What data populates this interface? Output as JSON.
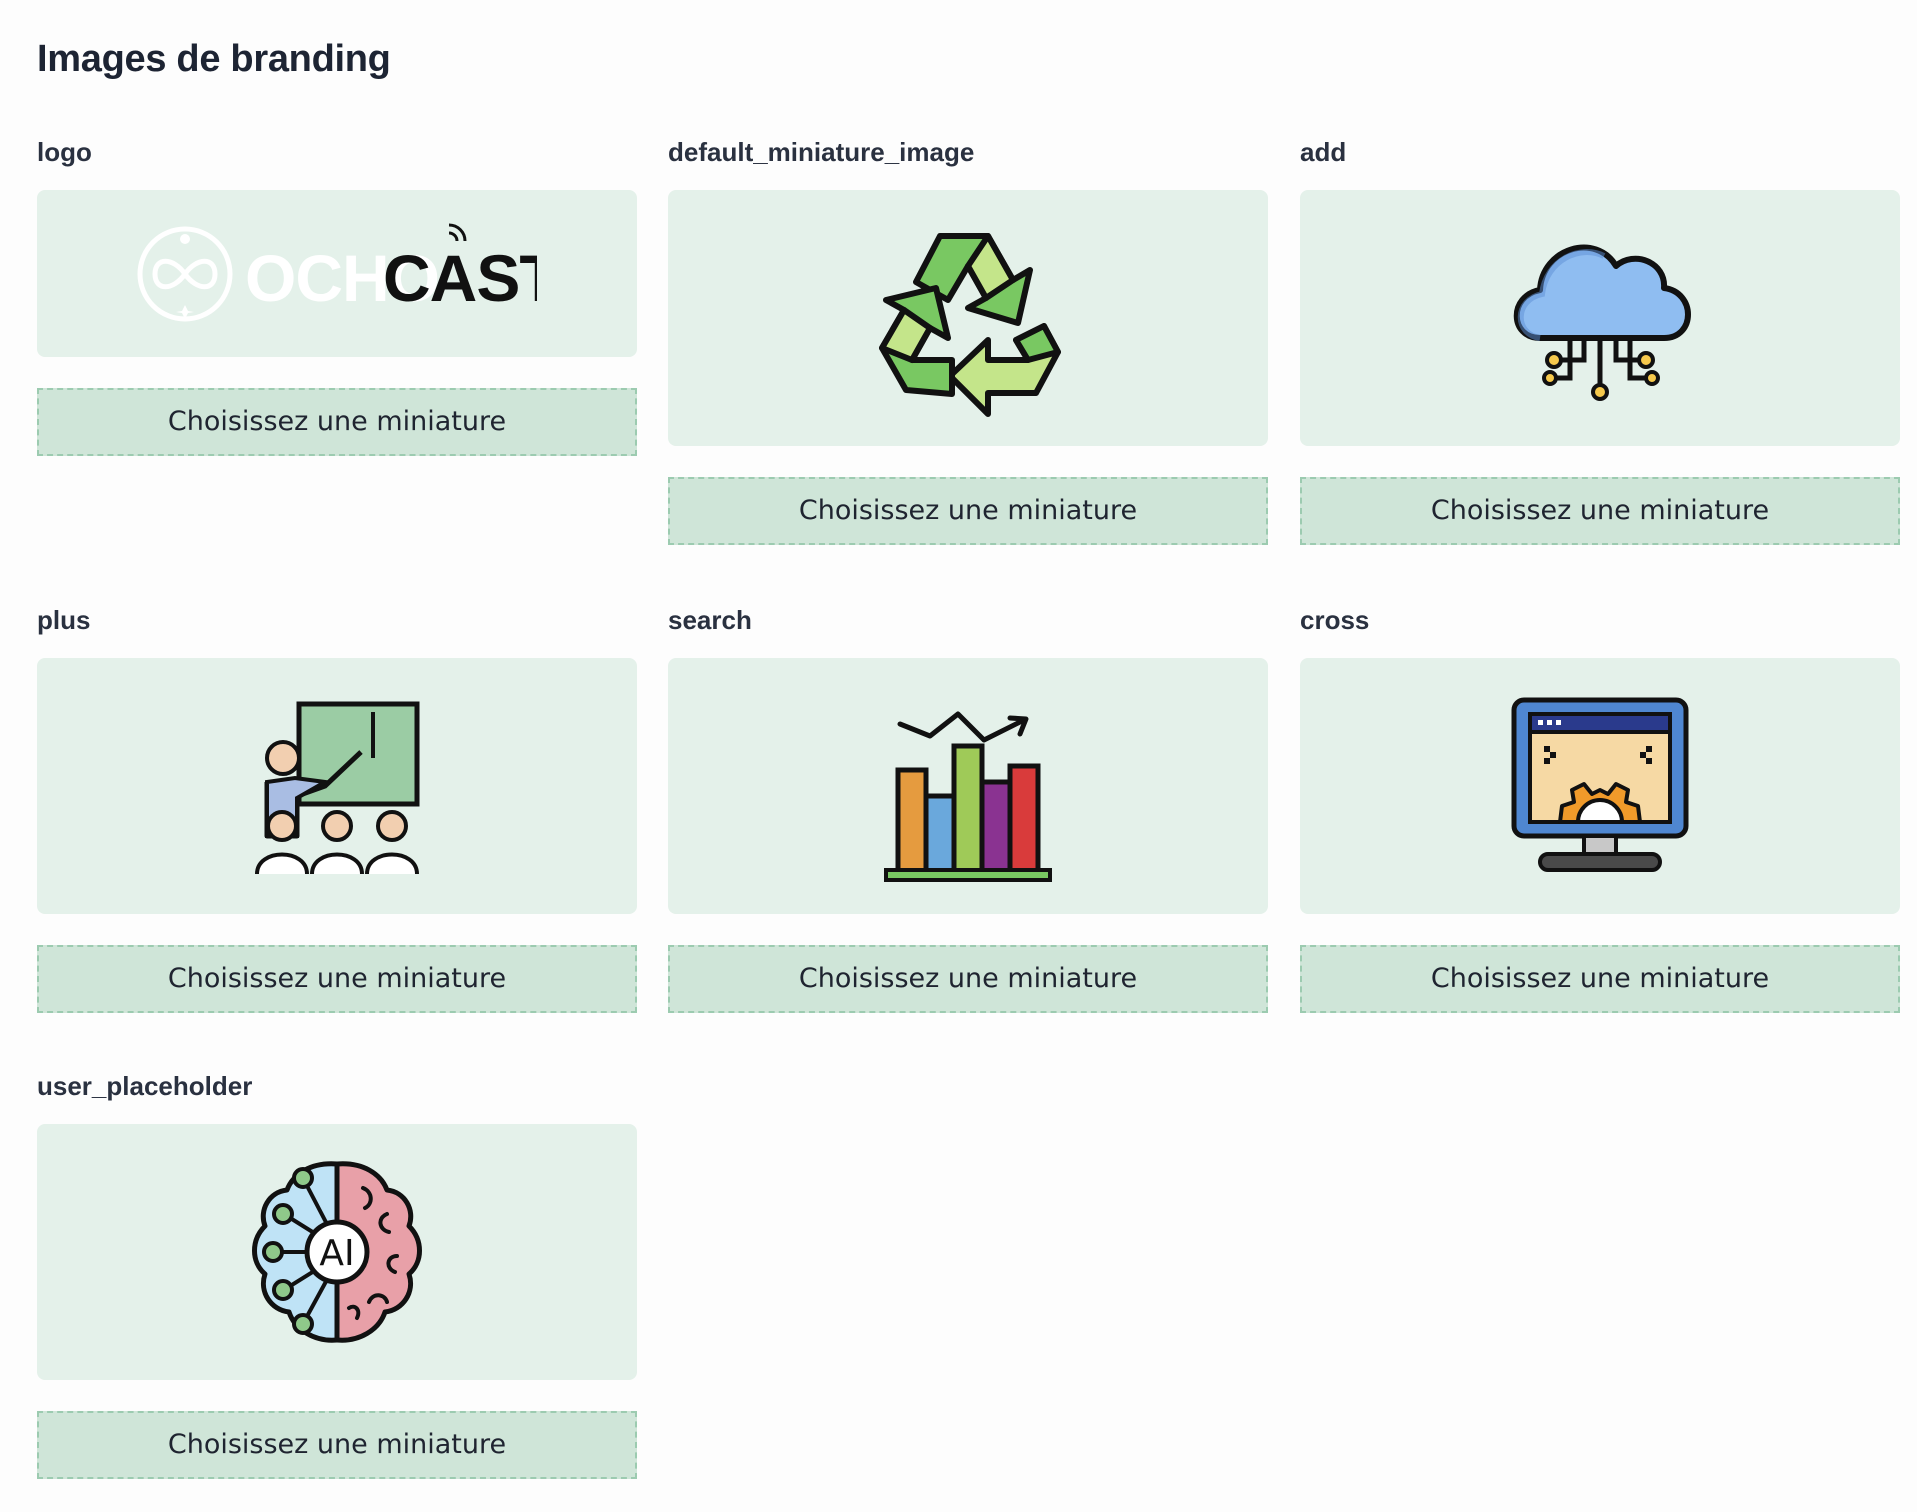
{
  "page": {
    "title": "Images de branding"
  },
  "images": [
    {
      "key": "logo",
      "icon": "ochocast-logo-icon",
      "button_label": "Choisissez une miniature",
      "logo_text_light": "OCHO",
      "logo_text_dark": "CAST"
    },
    {
      "key": "default_miniature_image",
      "icon": "recycle-icon",
      "button_label": "Choisissez une miniature"
    },
    {
      "key": "add",
      "icon": "cloud-network-icon",
      "button_label": "Choisissez une miniature"
    },
    {
      "key": "plus",
      "icon": "presentation-classroom-icon",
      "button_label": "Choisissez une miniature"
    },
    {
      "key": "search",
      "icon": "bar-chart-icon",
      "button_label": "Choisissez une miniature"
    },
    {
      "key": "cross",
      "icon": "monitor-settings-icon",
      "button_label": "Choisissez une miniature"
    },
    {
      "key": "user_placeholder",
      "icon": "ai-brain-icon",
      "button_label": "Choisissez une miniature",
      "icon_text": "AI"
    }
  ],
  "colors": {
    "preview_bg": "#e4f1ea",
    "button_bg": "#cfe5d8",
    "button_border": "#9ccbb0",
    "text": "#1d2433"
  }
}
